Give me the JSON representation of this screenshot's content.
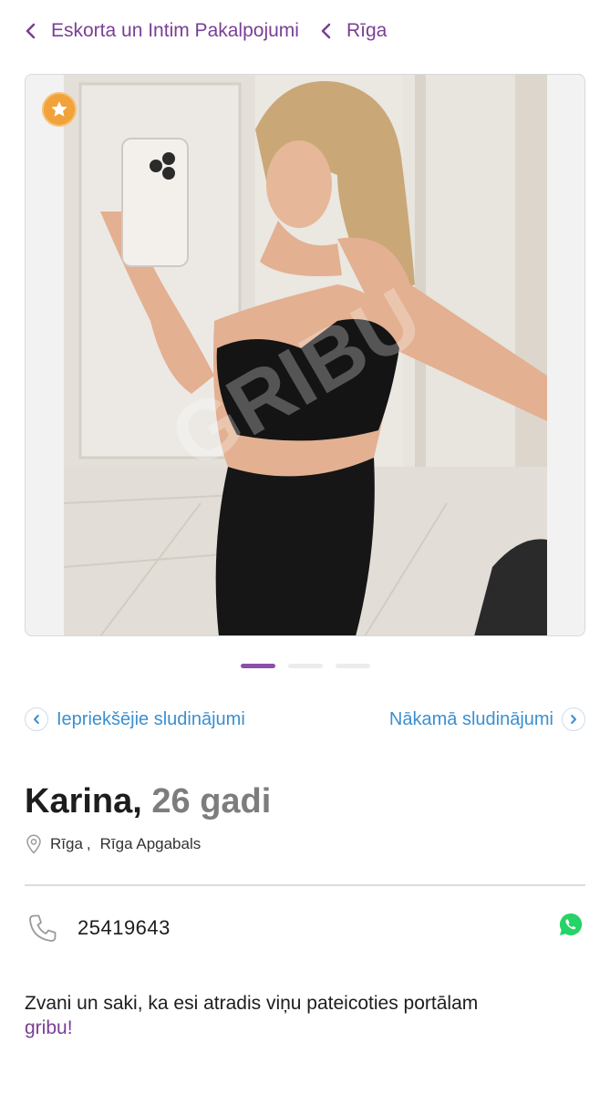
{
  "breadcrumb": {
    "items": [
      {
        "label": "Eskorta un Intim Pakalpojumi"
      },
      {
        "label": "Rīga"
      }
    ]
  },
  "gallery": {
    "watermark": "GRIBU",
    "slides_total": 3,
    "active_slide": 1,
    "badge_icon": "star-icon"
  },
  "pager": {
    "prev_label": "Iepriekšējie sludinājumi",
    "next_label": "Nākamā sludinājumi"
  },
  "profile": {
    "name": "Karina,",
    "age": "26 gadi",
    "city": "Rīga",
    "separator": ",",
    "region": "Rīga Apgabals"
  },
  "contact": {
    "phone": "25419643",
    "whatsapp_icon": "whatsapp-icon"
  },
  "cta": {
    "text": "Zvani un saki, ka esi atradis viņu pateicoties portālam",
    "brand": "gribu!"
  },
  "colors": {
    "brand": "#7a3f95",
    "link": "#3b8fd0",
    "badge": "#f2a23a",
    "whatsapp": "#25d366"
  }
}
